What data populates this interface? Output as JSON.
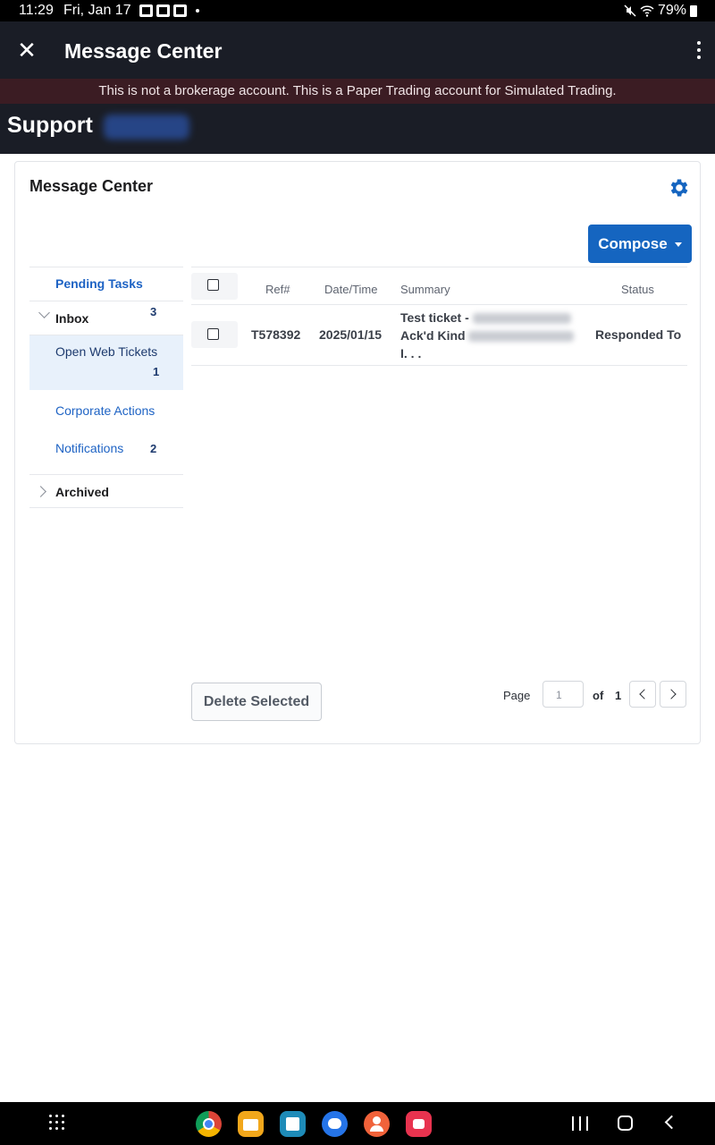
{
  "status_bar": {
    "time": "11:29",
    "date": "Fri, Jan 17",
    "battery": "79%"
  },
  "app_bar": {
    "close_glyph": "✕",
    "title": "Message Center"
  },
  "banner": {
    "text": "This is not a brokerage account. This is a Paper Trading account for Simulated Trading."
  },
  "support": {
    "title": "Support"
  },
  "card": {
    "title": "Message Center",
    "compose_label": "Compose"
  },
  "sidebar": {
    "pending_tasks": "Pending Tasks",
    "inbox": {
      "label": "Inbox",
      "count": "3"
    },
    "open_web_tickets": {
      "label": "Open Web Tickets",
      "count": "1"
    },
    "corporate_actions": {
      "label": "Corporate Actions"
    },
    "notifications": {
      "label": "Notifications",
      "count": "2"
    },
    "archived": {
      "label": "Archived"
    }
  },
  "table": {
    "headers": {
      "ref": "Ref#",
      "datetime": "Date/Time",
      "summary": "Summary",
      "status": "Status"
    },
    "rows": [
      {
        "ref": "T578392",
        "datetime": "2025/01/15",
        "summary_line1": "Test ticket -",
        "summary_line2": "Ack'd Kind",
        "summary_line3": "I. . .",
        "status": "Responded To"
      }
    ]
  },
  "footer": {
    "delete_label": "Delete Selected",
    "page_label": "Page",
    "page_input_value": "1",
    "of_label": "of",
    "total_pages": "1"
  },
  "colors": {
    "accent": "#1565c0",
    "appbar_bg": "#1a1d26",
    "banner_bg": "#3b1c23"
  }
}
